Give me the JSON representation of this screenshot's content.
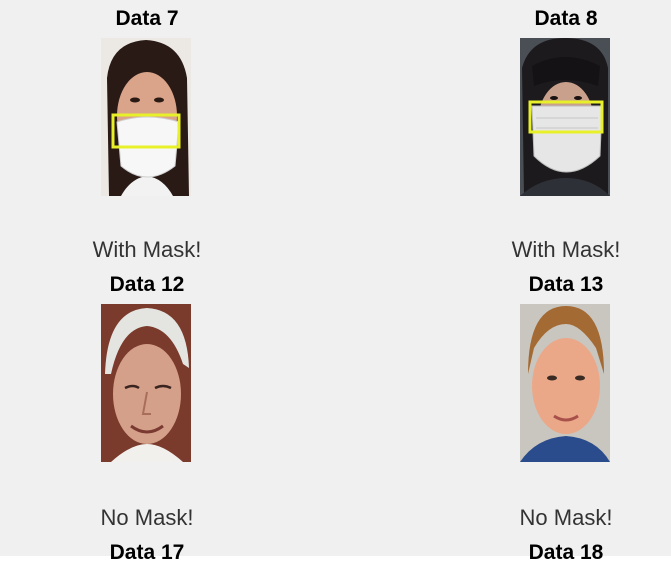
{
  "panels": [
    {
      "title": "Data 7",
      "caption": "With Mask!",
      "image": "face-with-surgical-mask"
    },
    {
      "title": "Data 8",
      "caption": "With Mask!",
      "image": "face-with-surgical-mask"
    },
    {
      "title": "Data 12",
      "caption": "No Mask!",
      "image": "face-elderly-man"
    },
    {
      "title": "Data 13",
      "caption": "No Mask!",
      "image": "face-man"
    },
    {
      "title": "Data 17",
      "caption": "",
      "image": ""
    },
    {
      "title": "Data 18",
      "caption": "",
      "image": ""
    }
  ],
  "colors": {
    "figure_bg": "#f0f0f0",
    "detection_box": "#e8f02a"
  }
}
